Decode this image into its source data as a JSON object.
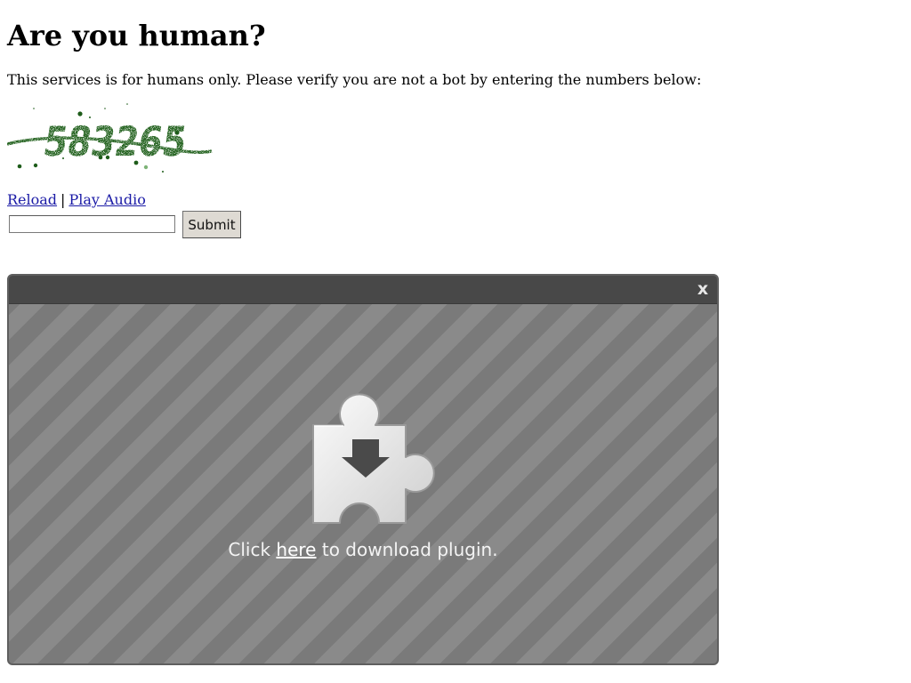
{
  "page": {
    "title": "Are you human?",
    "intro": "This services is for humans only. Please verify you are not a bot by entering the numbers below:"
  },
  "captcha": {
    "code": "583265",
    "ink_color": "#2f6b2a",
    "reload_label": "Reload",
    "separator": "|",
    "audio_label": "Play Audio"
  },
  "form": {
    "answer_value": "",
    "submit_label": "Submit"
  },
  "plugin": {
    "close_label": "x",
    "icon": "puzzle-download-icon",
    "message_prefix": "Click",
    "link_label": "here",
    "message_suffix": "to download plugin."
  }
}
